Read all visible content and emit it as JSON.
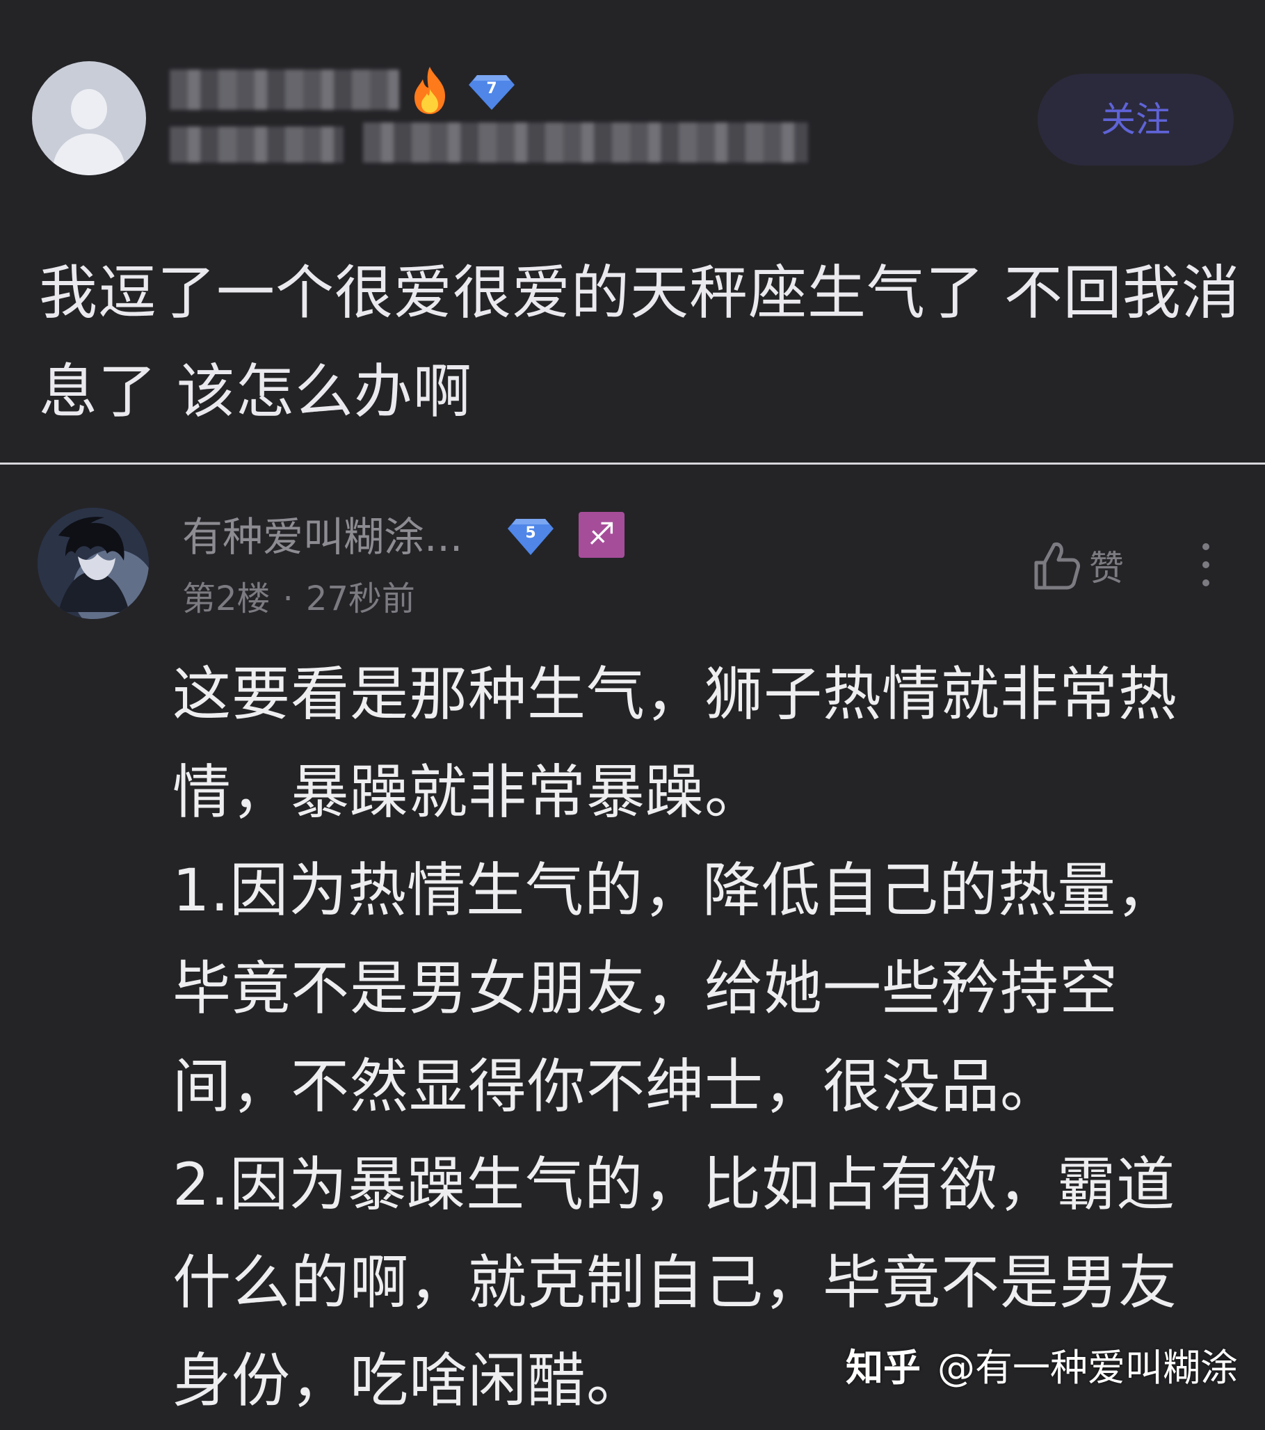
{
  "post": {
    "follow_label": "关注",
    "author_level": "7",
    "text": "我逗了一个很爱很爱的天秤座生气了 不回我消息了 该怎么办啊"
  },
  "reply": {
    "username": "有种爱叫糊涂...",
    "user_level": "5",
    "zodiac_glyph": "♐",
    "floor": "第2楼",
    "separator": "·",
    "time": "27秒前",
    "like_label": "赞",
    "lines": [
      "这要看是那种生气，狮子热情就非常热",
      "情，暴躁就非常暴躁。",
      "1.因为热情生气的，降低自己的热量，",
      "毕竟不是男女朋友，给她一些矜持空",
      "间，不然显得你不绅士，很没品。",
      "2.因为暴躁生气的，比如占有欲，霸道",
      "什么的啊，就克制自己，毕竟不是男友",
      "身份，吃啥闲醋。"
    ]
  },
  "watermark": {
    "brand": "知乎",
    "handle": "@有一种爱叫糊涂"
  },
  "colors": {
    "background": "#242427",
    "follow_text": "#5f63d8",
    "follow_bg": "#2b2a3c",
    "level_badge": "#4f86e8",
    "zodiac_badge": "#a64d9a"
  }
}
